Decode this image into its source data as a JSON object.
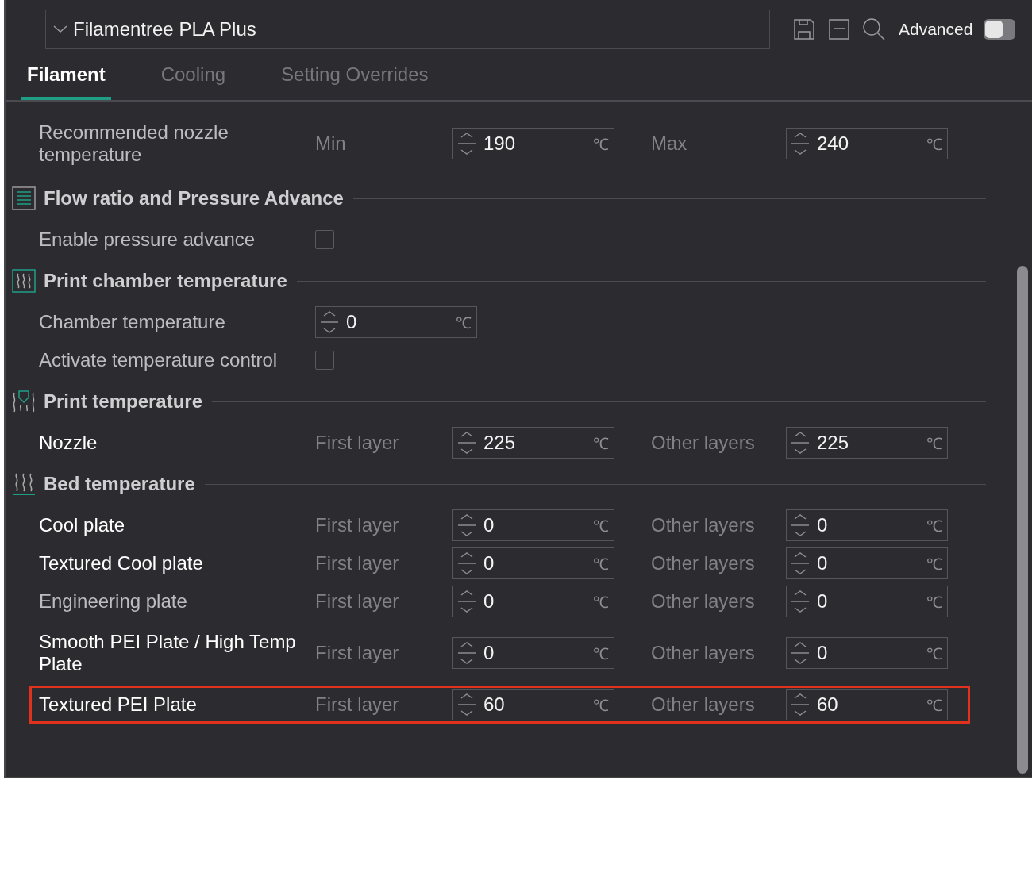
{
  "preset": {
    "name": "Filamentree PLA Plus"
  },
  "toolbar": {
    "advanced_label": "Advanced",
    "advanced_on": false
  },
  "tabs": [
    {
      "label": "Filament",
      "selected": true
    },
    {
      "label": "Cooling",
      "selected": false
    },
    {
      "label": "Setting Overrides",
      "selected": false
    }
  ],
  "sections": [
    {
      "rows": [
        {
          "kind": "range",
          "label": "Recommended nozzle temperature",
          "modified": false,
          "highlighted": false,
          "fields": [
            {
              "caption": "Min",
              "value": "190",
              "unit": "℃"
            },
            {
              "caption": "Max",
              "value": "240",
              "unit": "℃"
            }
          ]
        }
      ]
    },
    {
      "title": "Flow ratio and Pressure Advance",
      "rows": [
        {
          "kind": "checkbox",
          "label": "Enable pressure advance",
          "modified": false,
          "highlighted": false,
          "checked": false
        }
      ]
    },
    {
      "title": "Print chamber temperature",
      "rows": [
        {
          "kind": "spin",
          "label": "Chamber temperature",
          "modified": false,
          "highlighted": false,
          "fields": [
            {
              "value": "0",
              "unit": "℃"
            }
          ]
        },
        {
          "kind": "checkbox",
          "label": "Activate temperature control",
          "modified": false,
          "highlighted": false,
          "checked": false
        }
      ]
    },
    {
      "title": "Print temperature",
      "rows": [
        {
          "kind": "range",
          "label": "Nozzle",
          "modified": true,
          "highlighted": false,
          "fields": [
            {
              "caption": "First layer",
              "value": "225",
              "unit": "℃"
            },
            {
              "caption": "Other layers",
              "value": "225",
              "unit": "℃"
            }
          ]
        }
      ]
    },
    {
      "title": "Bed temperature",
      "rows": [
        {
          "kind": "range",
          "label": "Cool plate",
          "modified": true,
          "highlighted": false,
          "fields": [
            {
              "caption": "First layer",
              "value": "0",
              "unit": "℃"
            },
            {
              "caption": "Other layers",
              "value": "0",
              "unit": "℃"
            }
          ]
        },
        {
          "kind": "range",
          "label": "Textured Cool plate",
          "modified": true,
          "highlighted": false,
          "fields": [
            {
              "caption": "First layer",
              "value": "0",
              "unit": "℃"
            },
            {
              "caption": "Other layers",
              "value": "0",
              "unit": "℃"
            }
          ]
        },
        {
          "kind": "range",
          "label": "Engineering plate",
          "modified": false,
          "highlighted": false,
          "fields": [
            {
              "caption": "First layer",
              "value": "0",
              "unit": "℃"
            },
            {
              "caption": "Other layers",
              "value": "0",
              "unit": "℃"
            }
          ]
        },
        {
          "kind": "range",
          "label": "Smooth PEI Plate / High Temp Plate",
          "modified": true,
          "highlighted": false,
          "fields": [
            {
              "caption": "First layer",
              "value": "0",
              "unit": "℃"
            },
            {
              "caption": "Other layers",
              "value": "0",
              "unit": "℃"
            }
          ]
        },
        {
          "kind": "range",
          "label": "Textured PEI Plate",
          "modified": true,
          "highlighted": true,
          "fields": [
            {
              "caption": "First layer",
              "value": "60",
              "unit": "℃"
            },
            {
              "caption": "Other layers",
              "value": "60",
              "unit": "℃"
            }
          ]
        }
      ]
    }
  ]
}
